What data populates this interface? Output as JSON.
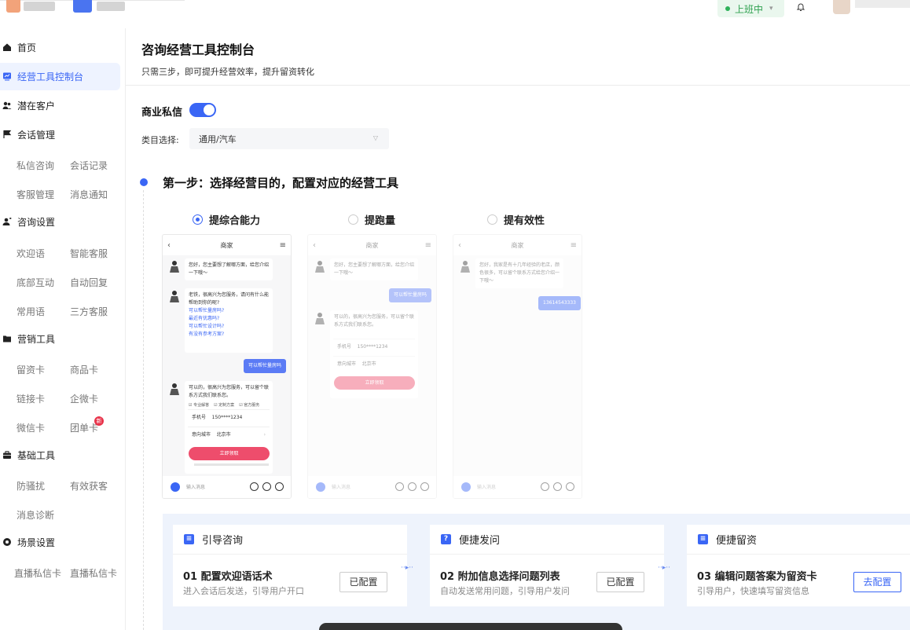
{
  "topbar": {
    "status": "上班中",
    "status_color": "#2fa14f"
  },
  "sidebar": {
    "groups": [
      {
        "label": "首页",
        "icon": "home-icon"
      },
      {
        "label": "经营工具控制台",
        "icon": "dashboard-icon",
        "active": true
      },
      {
        "label": "潜在客户",
        "icon": "users-icon"
      },
      {
        "label": "会话管理",
        "icon": "flag-icon",
        "items": [
          "私信咨询",
          "会话记录",
          "客服管理",
          "消息通知"
        ]
      },
      {
        "label": "咨询设置",
        "icon": "user-settings-icon",
        "items": [
          "欢迎语",
          "智能客服",
          "底部互动",
          "自动回复",
          "常用语",
          "三方客服"
        ]
      },
      {
        "label": "营销工具",
        "icon": "folder-icon",
        "items": [
          "留资卡",
          "商品卡",
          "链接卡",
          "企微卡",
          "微信卡",
          "团单卡"
        ]
      },
      {
        "label": "基础工具",
        "icon": "briefcase-icon",
        "items": [
          "防骚扰",
          "有效获客",
          "消息诊断"
        ]
      },
      {
        "label": "场景设置",
        "icon": "target-icon",
        "items": [
          "直播私信卡",
          "直播私信卡"
        ]
      }
    ],
    "new_badge": "新"
  },
  "main": {
    "title": "咨询经营工具控制台",
    "subtitle": "只需三步，即可提升经营效率，提升留资转化",
    "biz_label": "商业私信",
    "biz_enabled": true,
    "category_label": "类目选择:",
    "category_value": "通用/汽车",
    "step1_title": "第一步：选择经营目的，配置对应的经营工具",
    "goals": [
      {
        "label": "提综合能力",
        "selected": true
      },
      {
        "label": "提跑量",
        "selected": false
      },
      {
        "label": "提有效性",
        "selected": false
      }
    ],
    "phone": {
      "header": "商家",
      "msg1": "您好，您主要想了解哪方面，给您介绍一下哦～",
      "msg2": "老铁，很高兴为您服务，请问有什么能帮助到你的呢?",
      "links": [
        "可以帮忙量房吗?",
        "最近有优惠吗?",
        "可以帮忙设计吗?",
        "有没有参考方案?"
      ],
      "user_msg": "可以帮忙量房吗",
      "msg3": "可以的，很高兴为您服务，可以留个联系方式我们联系您。",
      "checks": [
        "专业解答",
        "定制方案",
        "官方服务"
      ],
      "phone_label": "手机号",
      "phone_value": "150****1234",
      "city_label": "意向城市",
      "city_value": "北京市",
      "cta": "立即领取",
      "input_placeholder": "输入消息"
    },
    "phone3": {
      "msg1": "您好，我家是有十几年经验的老店，颜色很多，可以留个联系方式给您介绍一下哦～",
      "user_msg": "13614543333"
    }
  },
  "flow": [
    {
      "head": "引导咨询",
      "title": "01 配置欢迎语话术",
      "desc": "进入会话后发送，引导用户开口",
      "button": "已配置",
      "icon_char": "≡"
    },
    {
      "head": "便捷发问",
      "title": "02 附加信息选择问题列表",
      "desc": "自动发送常用问题，引导用户发问",
      "button": "已配置",
      "icon_char": "?"
    },
    {
      "head": "便捷留资",
      "title": "03 编辑问题答案为留资卡",
      "desc": "引导用户，快速填写留资信息",
      "button": "去配置",
      "icon_char": "≡"
    }
  ]
}
